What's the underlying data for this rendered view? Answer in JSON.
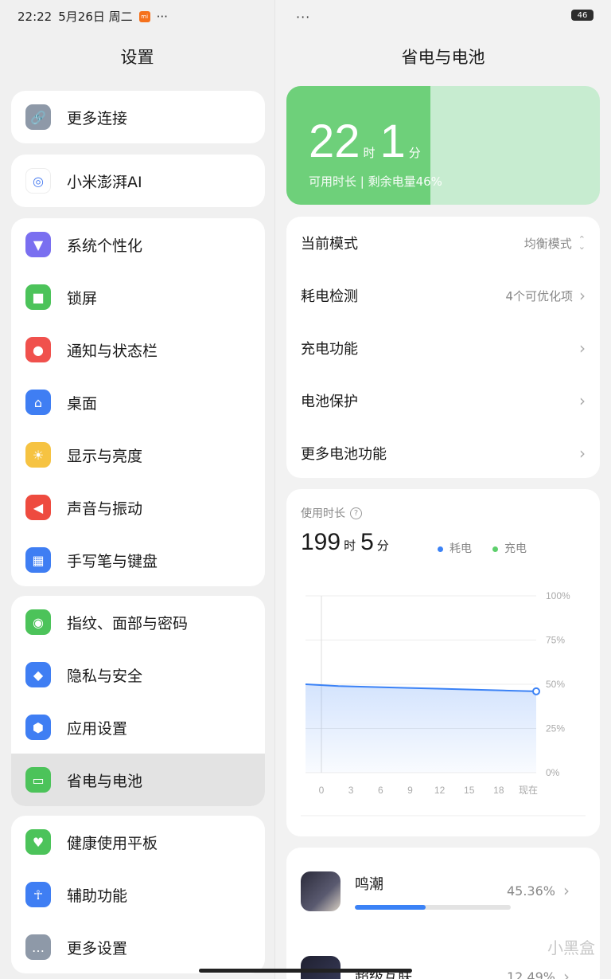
{
  "status": {
    "time": "22:22",
    "date": "5月26日 周二",
    "mi_badge": "mi",
    "more": "···",
    "battery": "46"
  },
  "left": {
    "title": "设置",
    "groups": [
      [
        {
          "label": "更多连接",
          "icon": "link-icon",
          "color": "#8e99a8"
        }
      ],
      [
        {
          "label": "小米澎湃AI",
          "icon": "ai-swirl-icon",
          "color": "#ffffff"
        }
      ],
      [
        {
          "label": "系统个性化",
          "icon": "brush-icon",
          "color": "#7a6ff0"
        },
        {
          "label": "锁屏",
          "icon": "lock-icon",
          "color": "#4cc35a"
        },
        {
          "label": "通知与状态栏",
          "icon": "notification-icon",
          "color": "#f0514d"
        },
        {
          "label": "桌面",
          "icon": "home-icon",
          "color": "#3f7ef3"
        },
        {
          "label": "显示与亮度",
          "icon": "sun-icon",
          "color": "#f6c342"
        },
        {
          "label": "声音与振动",
          "icon": "speaker-icon",
          "color": "#ee4b3f"
        },
        {
          "label": "手写笔与键盘",
          "icon": "keyboard-icon",
          "color": "#3f7ef3"
        }
      ],
      [
        {
          "label": "指纹、面部与密码",
          "icon": "fingerprint-icon",
          "color": "#4cc35a"
        },
        {
          "label": "隐私与安全",
          "icon": "privacy-icon",
          "color": "#3f7ef3"
        },
        {
          "label": "应用设置",
          "icon": "app-settings-icon",
          "color": "#3f7ef3"
        },
        {
          "label": "省电与电池",
          "icon": "battery-icon",
          "color": "#4cc35a"
        }
      ],
      [
        {
          "label": "健康使用平板",
          "icon": "health-icon",
          "color": "#4cc35a"
        },
        {
          "label": "辅助功能",
          "icon": "accessibility-icon",
          "color": "#3f7ef3"
        },
        {
          "label": "更多设置",
          "icon": "more-icon",
          "color": "#8e99a8"
        }
      ]
    ]
  },
  "right": {
    "title": "省电与电池",
    "battery_card": {
      "hours": "22",
      "hour_unit": "时",
      "minutes": "1",
      "minute_unit": "分",
      "subtitle": "可用时长 | 剩余电量46%",
      "level": 0.46
    },
    "rows": [
      {
        "label": "当前模式",
        "value": "均衡模式",
        "chev": "⌃⌄"
      },
      {
        "label": "耗电检测",
        "value": "4个可优化项",
        "chev": "›"
      },
      {
        "label": "充电功能",
        "value": "",
        "chev": "›"
      },
      {
        "label": "电池保护",
        "value": "",
        "chev": "›"
      },
      {
        "label": "更多电池功能",
        "value": "",
        "chev": "›"
      }
    ],
    "usage": {
      "label": "使用时长",
      "hours": "199",
      "hour_unit": "时",
      "minutes": "5",
      "minute_unit": "分",
      "legend_drain": "耗电",
      "legend_charge": "充电",
      "drain_color": "#3b82f6",
      "charge_color": "#5dcf6c"
    },
    "apps": [
      {
        "name": "鸣潮",
        "pct": "45.36%",
        "share": 0.4536
      },
      {
        "name": "超级互联",
        "pct": "12.49%",
        "share": 0.1249
      }
    ]
  },
  "chart_data": {
    "type": "area",
    "x": [
      "0",
      "3",
      "6",
      "9",
      "12",
      "15",
      "18",
      "现在"
    ],
    "y_ticks": [
      "100%",
      "75%",
      "50%",
      "25%",
      "0%"
    ],
    "ylim": [
      0,
      100
    ],
    "series": [
      {
        "values": [
          50,
          49,
          48.5,
          48,
          47.5,
          47,
          46.5,
          46
        ]
      }
    ]
  },
  "watermark": "小黑盒"
}
